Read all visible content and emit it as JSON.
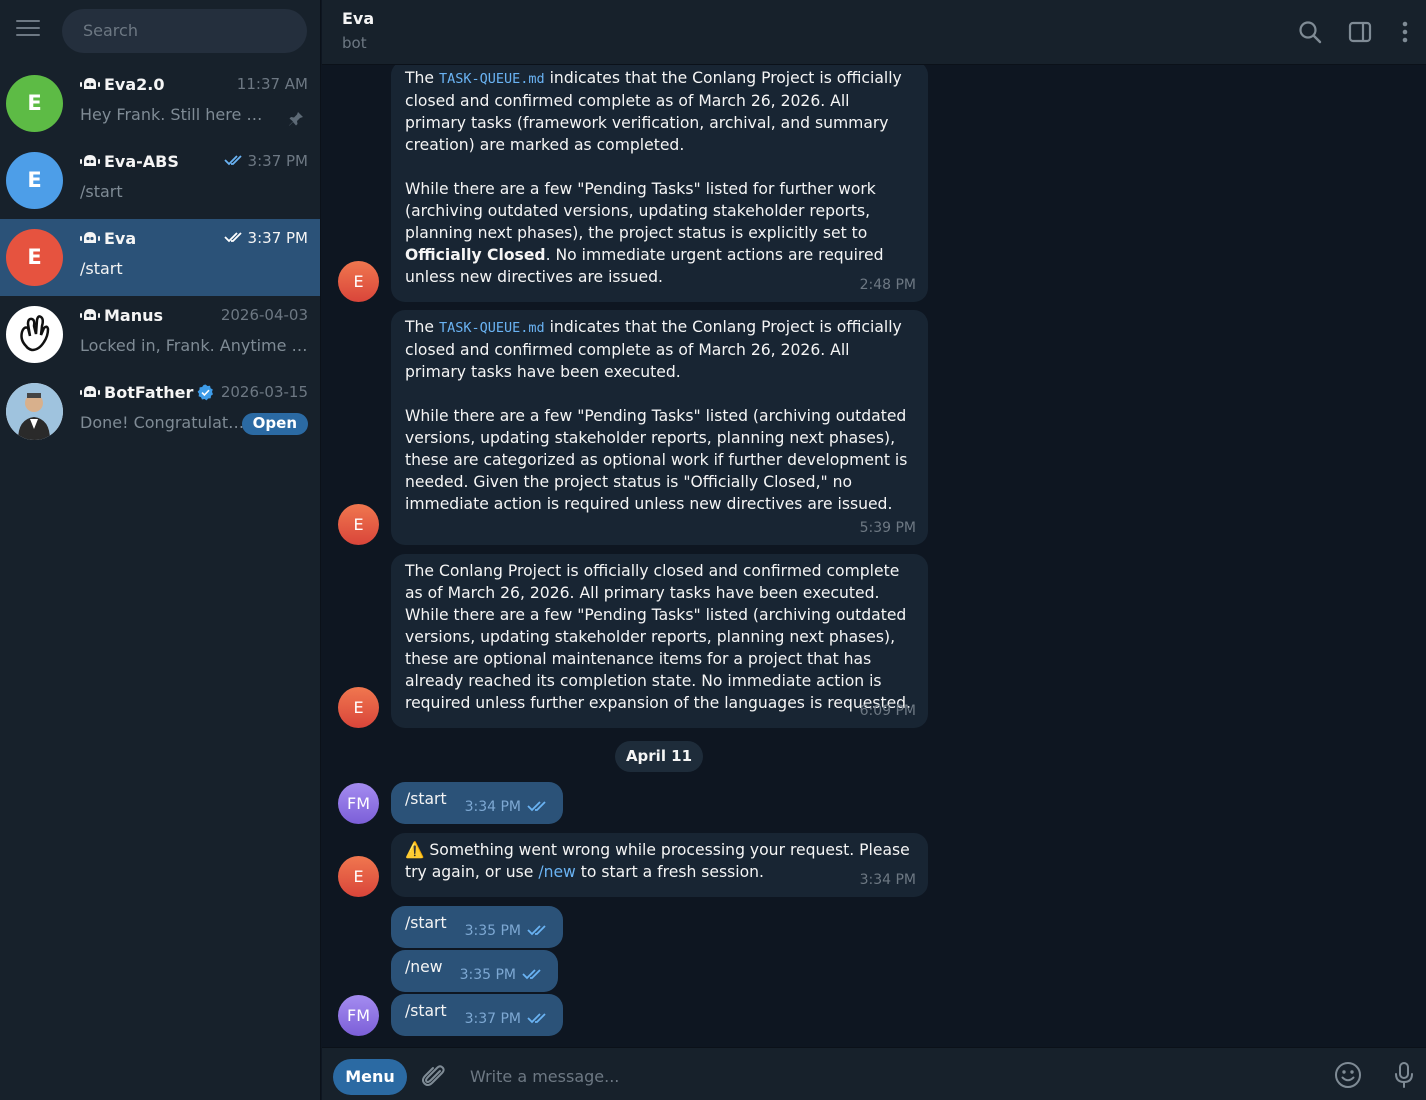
{
  "sidebar": {
    "search_placeholder": "Search",
    "chats": [
      {
        "name": "Eva2.0",
        "time": "11:37 AM",
        "preview": "Hey Frank. Still here — just wrapping up",
        "avatar_letter": "E",
        "avatar_color": "#5dbb45"
      },
      {
        "name": "Eva-ABS",
        "time": "3:37 PM",
        "preview": "/start",
        "avatar_letter": "E",
        "avatar_color": "#4d9ee8"
      },
      {
        "name": "Eva",
        "time": "3:37 PM",
        "preview": "/start",
        "avatar_letter": "E",
        "avatar_color": "#e6533f"
      },
      {
        "name": "Manus",
        "time": "2026-04-03",
        "preview": "Locked in, Frank. Anytime you need me",
        "avatar_letter": "",
        "avatar_color": "#ffffff"
      },
      {
        "name": "BotFather",
        "time": "2026-03-15",
        "preview": "Done! Congratulations on your new bot",
        "avatar_letter": "",
        "avatar_color": "#dfe6ee",
        "badge": "Open"
      }
    ]
  },
  "header": {
    "title": "Eva",
    "status": "bot"
  },
  "messages": [
    {
      "p1_before": "The ",
      "code": "TASK-QUEUE.md",
      "p1_after": " indicates that the Conlang Project is officially closed and confirmed complete as of March 26, 2026. All primary tasks (framework verification, archival, and summary creation) are marked as completed.",
      "p2_before": "While there are a few \"Pending Tasks\" listed for further work (archiving outdated versions, updating stakeholder reports, planning next phases), the project status is explicitly set to ",
      "p2_bold": "Officially Closed",
      "p2_after": ". No immediate urgent actions are required unless new directives are issued.",
      "time": "2:48 PM"
    },
    {
      "p1_before": "The ",
      "code": "TASK-QUEUE.md",
      "p1_after": " indicates that the Conlang Project is officially closed and confirmed complete as of March 26, 2026. All primary tasks have been executed.",
      "p2": "While there are a few \"Pending Tasks\" listed (archiving outdated versions, updating stakeholder reports, planning next phases), these are categorized as optional work if further development is needed. Given the project status is \"Officially Closed,\" no immediate action is required unless new directives are issued.",
      "time": "5:39 PM"
    },
    {
      "text": "The Conlang Project is officially closed and confirmed complete as of March 26, 2026. All primary tasks have been executed. While there are a few \"Pending Tasks\" listed (archiving outdated versions, updating stakeholder reports, planning next phases), these are optional maintenance items for a project that has already reached its completion state. No immediate action is required unless further expansion of the languages is requested.",
      "time": "6:09 PM"
    },
    {
      "date": "April 11"
    },
    {
      "text": "/start",
      "time": "3:34 PM",
      "sender": "FM"
    },
    {
      "warn": "⚠️",
      "before": " Something went wrong while processing your request. Please try again, or use ",
      "link": "/new",
      "after": " to start a fresh session.",
      "time": "3:34 PM"
    },
    {
      "text": "/start",
      "time": "3:35 PM"
    },
    {
      "text": "/new",
      "time": "3:35 PM"
    },
    {
      "text": "/start",
      "time": "3:37 PM",
      "sender": "FM"
    }
  ],
  "avatars": {
    "bot": "E",
    "user": "FM"
  },
  "composer": {
    "menu_label": "Menu",
    "placeholder": "Write a message..."
  }
}
